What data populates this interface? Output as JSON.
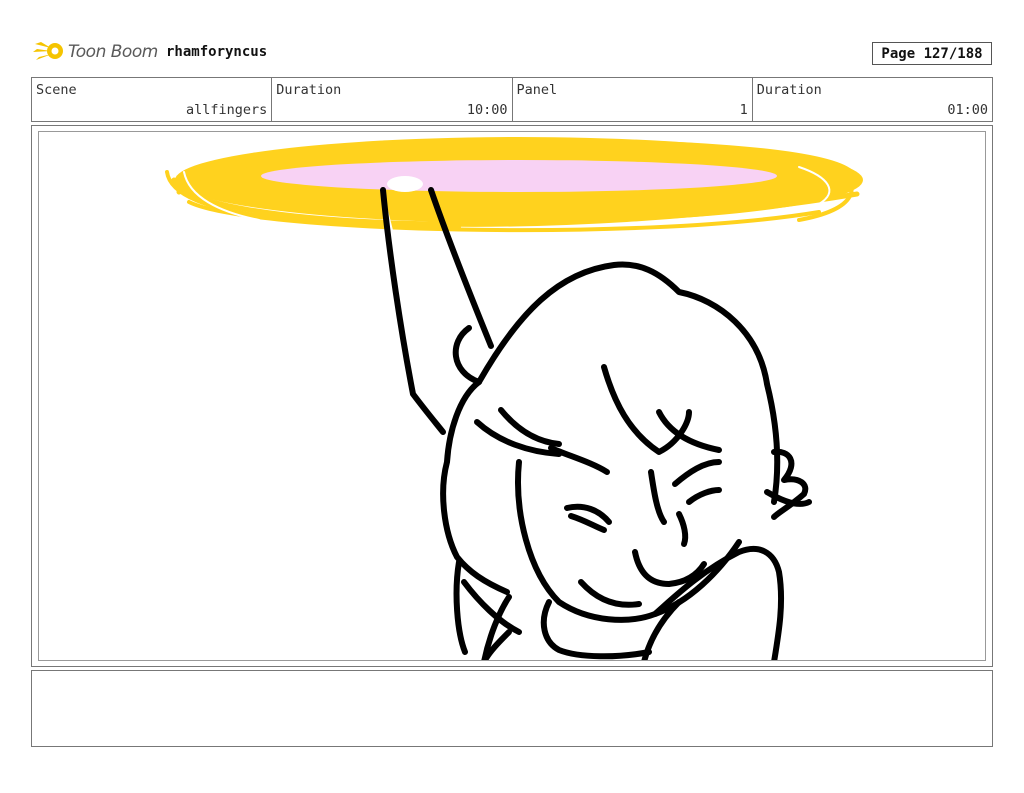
{
  "header": {
    "logo_text": "Toon Boom",
    "project": "rhamforyncus",
    "page": "Page 127/188"
  },
  "info": {
    "scene_label": "Scene",
    "scene_value": "allfingers",
    "scene_duration_label": "Duration",
    "scene_duration_value": "10:00",
    "panel_label": "Panel",
    "panel_value": "1",
    "panel_duration_label": "Duration",
    "panel_duration_value": "01:00"
  },
  "notes": {
    "text": ""
  }
}
